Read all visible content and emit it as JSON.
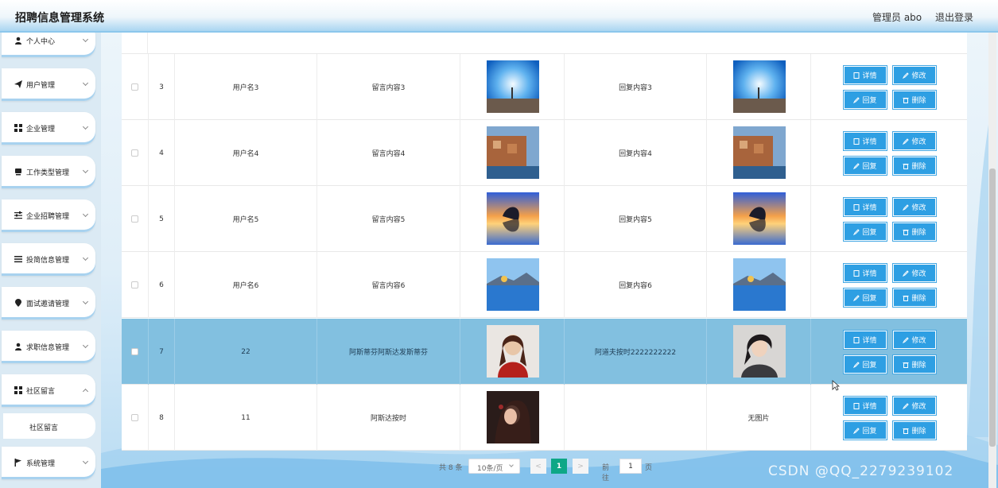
{
  "app": {
    "title": "招聘信息管理系统",
    "user_label": "管理员 abo",
    "logout_label": "退出登录"
  },
  "sidebar": {
    "items": [
      {
        "label": "个人中心",
        "icon": "user-icon"
      },
      {
        "label": "用户管理",
        "icon": "send-icon"
      },
      {
        "label": "企业管理",
        "icon": "grid-icon"
      },
      {
        "label": "工作类型管理",
        "icon": "device-icon"
      },
      {
        "label": "企业招聘管理",
        "icon": "sliders-icon"
      },
      {
        "label": "投简信息管理",
        "icon": "list-icon"
      },
      {
        "label": "面试邀请管理",
        "icon": "location-icon"
      },
      {
        "label": "求职信息管理",
        "icon": "user-icon"
      },
      {
        "label": "社区留言",
        "icon": "grid-icon"
      },
      {
        "label": "系统管理",
        "icon": "flag-icon"
      }
    ],
    "submenu": {
      "label": "社区留言"
    }
  },
  "table": {
    "rows": [
      {
        "index": "3",
        "username": "用户名3",
        "message": "留言内容3",
        "reply": "回复内容3",
        "message_image": "beach-figure",
        "reply_image": "beach-figure"
      },
      {
        "index": "4",
        "username": "用户名4",
        "message": "留言内容4",
        "reply": "回复内容4",
        "message_image": "coastal-town",
        "reply_image": "coastal-town"
      },
      {
        "index": "5",
        "username": "用户名5",
        "message": "留言内容5",
        "reply": "回复内容5",
        "message_image": "sunset-rock",
        "reply_image": "sunset-rock"
      },
      {
        "index": "6",
        "username": "用户名6",
        "message": "留言内容6",
        "reply": "回复内容6",
        "message_image": "lake-mountain",
        "reply_image": "lake-mountain"
      },
      {
        "index": "7",
        "username": "22",
        "message": "阿斯蒂芬阿斯达发斯蒂芬",
        "reply": "阿道夫按时2222222222",
        "message_image": "woman-red-dress",
        "reply_image": "anime-man"
      },
      {
        "index": "8",
        "username": "11",
        "message": "阿斯达按时",
        "reply": "",
        "message_image": "woman-dark",
        "reply_image_text": "无图片"
      }
    ],
    "actions": {
      "detail": "详情",
      "edit": "修改",
      "reply": "回复",
      "delete": "删除"
    }
  },
  "pagination": {
    "total": "共 8 条",
    "page_size": "10条/页",
    "current": "1",
    "prev": "<",
    "next": ">",
    "goto_label": "前往",
    "goto_value": "1",
    "page_unit": "页"
  },
  "watermark": "CSDN @QQ_2279239102"
}
